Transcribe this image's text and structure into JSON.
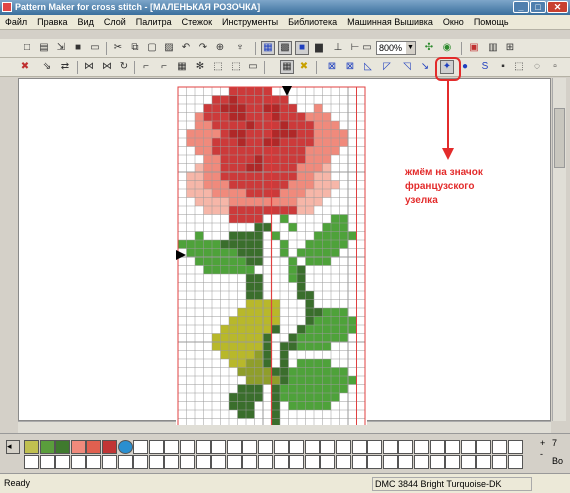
{
  "window": {
    "title": "Pattern Maker for cross stitch - [МАЛЕНЬКАЯ РОЗОЧКА]",
    "controls": [
      "_",
      "□",
      "✕"
    ]
  },
  "menu": [
    "Файл",
    "Правка",
    "Вид",
    "Слой",
    "Палитра",
    "Стежок",
    "Инструменты",
    "Библиотека",
    "Машинная Вышивка",
    "Окно",
    "Помощь"
  ],
  "toolbar1": {
    "zoom_value": "800%"
  },
  "annotation": {
    "text_lines": [
      "жмём на значок",
      "французского",
      "узелка"
    ],
    "color": "#e32b2b"
  },
  "pattern": {
    "colors": {
      "r": "#cc3a3a",
      "d": "#b02828",
      "p": "#f08a7c",
      "l": "#f6b6a8",
      "g": "#4ea23a",
      "k": "#3a6e2c",
      "y": "#b8b82a",
      "o": "#8f9e2a"
    },
    "rows": [
      "......rrrrr...........",
      "....rrdrrrrrr.........",
      "...rrdddrrddrr..p.....",
      "..prrrddrrrdrrrppp....",
      "..pprrrrdrrrdrrrppp...",
      ".pppprddrrrdddrrpppp..",
      ".ppprrrdrrddrrrrpppp..",
      "..pprrrrrrrrrrrpppp...",
      "...pprrrrdrrrrrppp....",
      "..lpprrrddrrrrpppl....",
      ".llpprrrrrrrrrppll....",
      ".llppprrrrrrrppplll...",
      ".lllpppprrrrppplll....",
      "..llllpppppppplll.....",
      "...lllrrrrrrrrll......",
      "......rrrr..g.....gg..",
      ".........kk..g...ggg..",
      "..g...kkkk.g....ggggg.",
      "gggggkkkkk..g..ggggg..",
      ".ggggggkkk..g.ggggg...",
      "..ggggggkk...g.ggg....",
      "...gggggg....gk.......",
      "........kk...gk.......",
      "........kk....k.......",
      "........kk....kk......",
      "........yyyy...k......",
      ".......yyyyy...kkggg..",
      "......yyyyyy...kggggg.",
      ".....yyyyyyk..kgggggg.",
      "....yyyyyyk..kgggggg..",
      "....yyyyyyk.kkgggg....",
      ".....yyyyok.k.........",
      "......yyook.k.gggg....",
      ".......ooookkggggggg..",
      "........ooookgggggggg.",
      ".......kkk.kgggggggg..",
      "......kkkk.kggggggg...",
      "......kkk..k.ggggg....",
      ".......kk..k..........",
      "...........k.........."
    ]
  },
  "palette_colors": [
    "#c0c050",
    "#5a9e3c",
    "#3f7a2e",
    "#f08a7c",
    "#e06050",
    "#c03535",
    "#2a8fd0"
  ],
  "palette_right": [
    "+",
    "-",
    "7",
    "Bo"
  ],
  "status": {
    "left": "Ready",
    "right": "DMC 3844 Bright Turquoise-DK"
  }
}
